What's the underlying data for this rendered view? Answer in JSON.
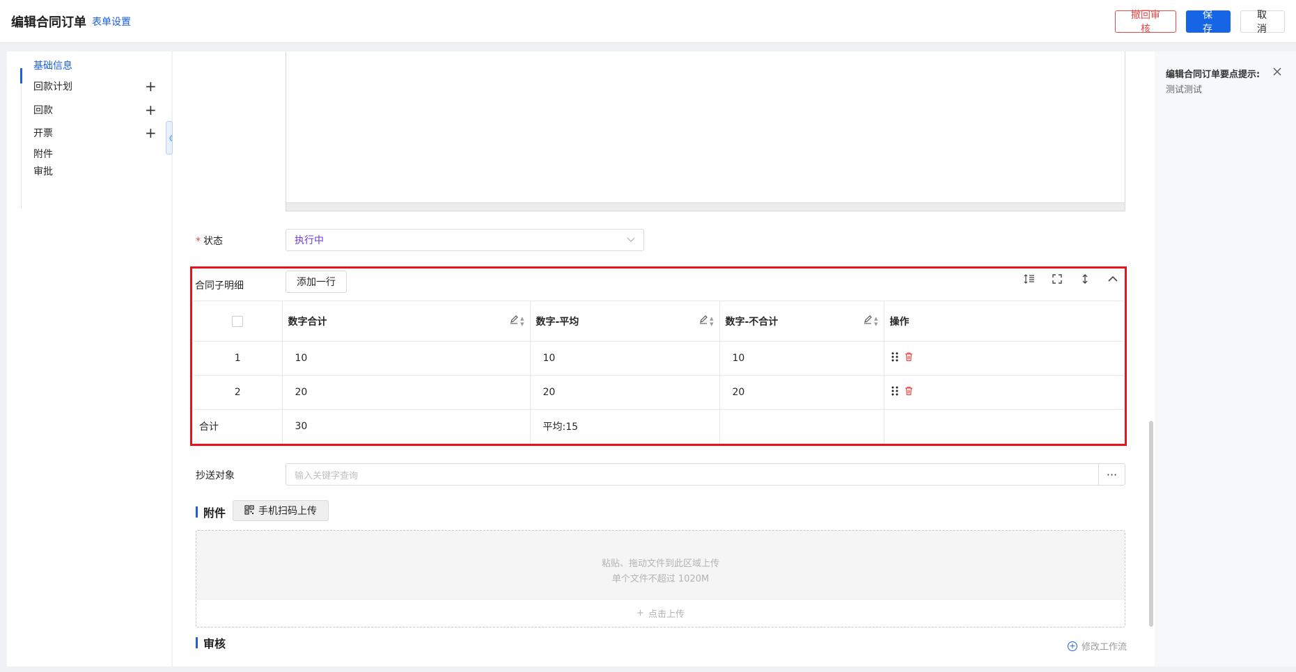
{
  "header": {
    "title": "编辑合同订单",
    "form_settings": "表单设置",
    "recall_label": "撤回审核",
    "save_label": "保存",
    "cancel_label": "取消"
  },
  "sidebar": {
    "items": [
      {
        "label": "基础信息"
      },
      {
        "label": "回款计划",
        "plus": "+"
      },
      {
        "label": "回款",
        "plus": "+"
      },
      {
        "label": "开票",
        "plus": "+"
      },
      {
        "label": "附件"
      },
      {
        "label": "审批"
      }
    ],
    "collapse_glyph": "《"
  },
  "form": {
    "status": {
      "label": "状态",
      "required_mark": "*",
      "value": "执行中"
    },
    "detail": {
      "label": "合同子明细",
      "add_row_label": "添加一行",
      "columns": [
        "数字合计",
        "数字-平均",
        "数字-不合计",
        "操作"
      ],
      "rows": [
        {
          "index": "1",
          "sum": "10",
          "avg": "10",
          "nosum": "10"
        },
        {
          "index": "2",
          "sum": "20",
          "avg": "20",
          "nosum": "20"
        }
      ],
      "summary": {
        "label": "合计",
        "sum": "30",
        "avg": "平均:15",
        "nosum": ""
      }
    },
    "cc": {
      "label": "抄送对象",
      "placeholder": "输入关键字查询",
      "more": "···"
    },
    "attachment": {
      "title": "附件",
      "qr_label": "手机扫码上传",
      "hint1": "粘贴、拖动文件到此区域上传",
      "hint2": "单个文件不超过 1020M",
      "click_upload": "点击上传"
    },
    "review": {
      "title": "审核",
      "modify_flow": "修改工作流"
    }
  },
  "tips": {
    "title": "编辑合同订单要点提示:",
    "content": "测试测试"
  },
  "colors": {
    "accent": "#1a5fe6",
    "danger": "#e24a4a",
    "highlight": "#e8121a",
    "status_value": "#6c3ad8"
  }
}
